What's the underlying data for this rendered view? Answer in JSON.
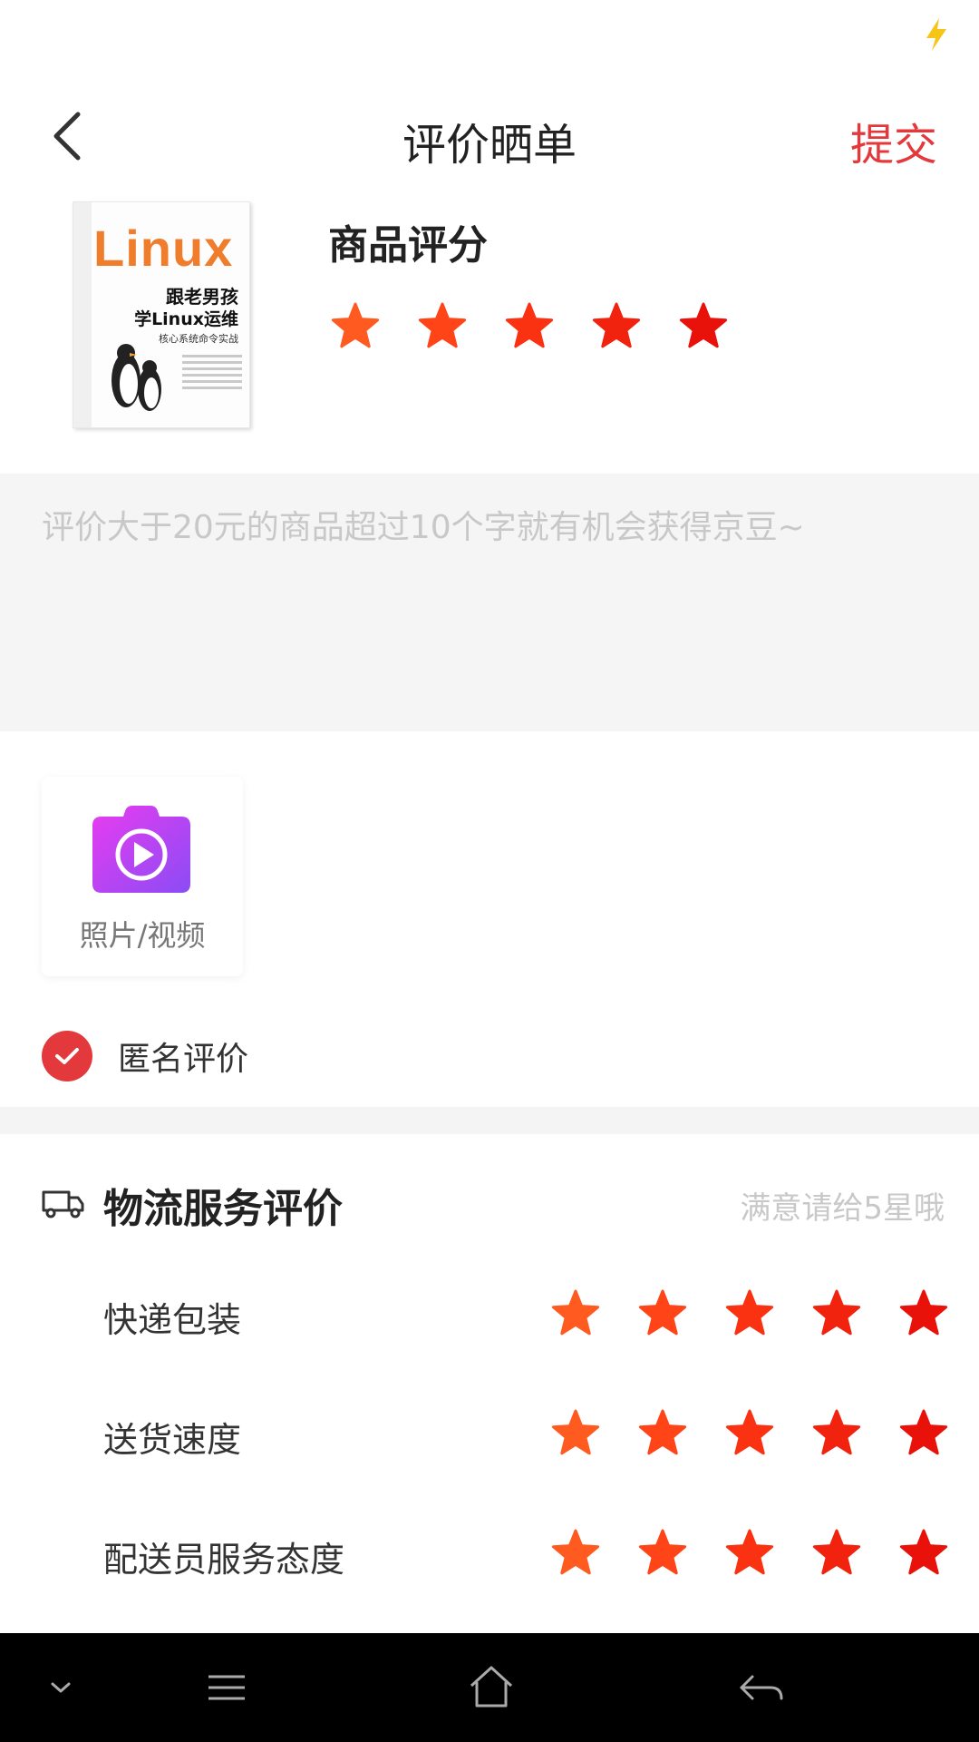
{
  "header": {
    "title": "评价晒单",
    "submit_label": "提交"
  },
  "product": {
    "cover": {
      "brand": "Linux",
      "title_line1": "跟老男孩",
      "title_line2": "学Linux运维",
      "subtitle": "核心系统命令实战"
    },
    "rating_title": "商品评分",
    "rating": 5,
    "max_rating": 5
  },
  "review": {
    "placeholder": "评价大于20元的商品超过10个字就有机会获得京豆~",
    "value": ""
  },
  "upload": {
    "label": "照片/视频",
    "icon": "camera-video-icon"
  },
  "anonymous": {
    "label": "匿名评价",
    "checked": true
  },
  "logistics": {
    "title": "物流服务评价",
    "hint": "满意请给5星哦",
    "icon": "truck-icon",
    "items": [
      {
        "label": "快递包装",
        "rating": 5
      },
      {
        "label": "送货速度",
        "rating": 5
      },
      {
        "label": "配送员服务态度",
        "rating": 5
      }
    ]
  },
  "colors": {
    "accent": "#e4393c",
    "star_gradient": [
      "#ff5a1f",
      "#ff4418",
      "#fa3212",
      "#f2230e",
      "#e8120b"
    ],
    "placeholder": "#c8c8c8"
  },
  "navbar": {
    "icons": [
      "chevron-down-icon",
      "menu-icon",
      "home-icon",
      "back-arrow-icon"
    ]
  }
}
